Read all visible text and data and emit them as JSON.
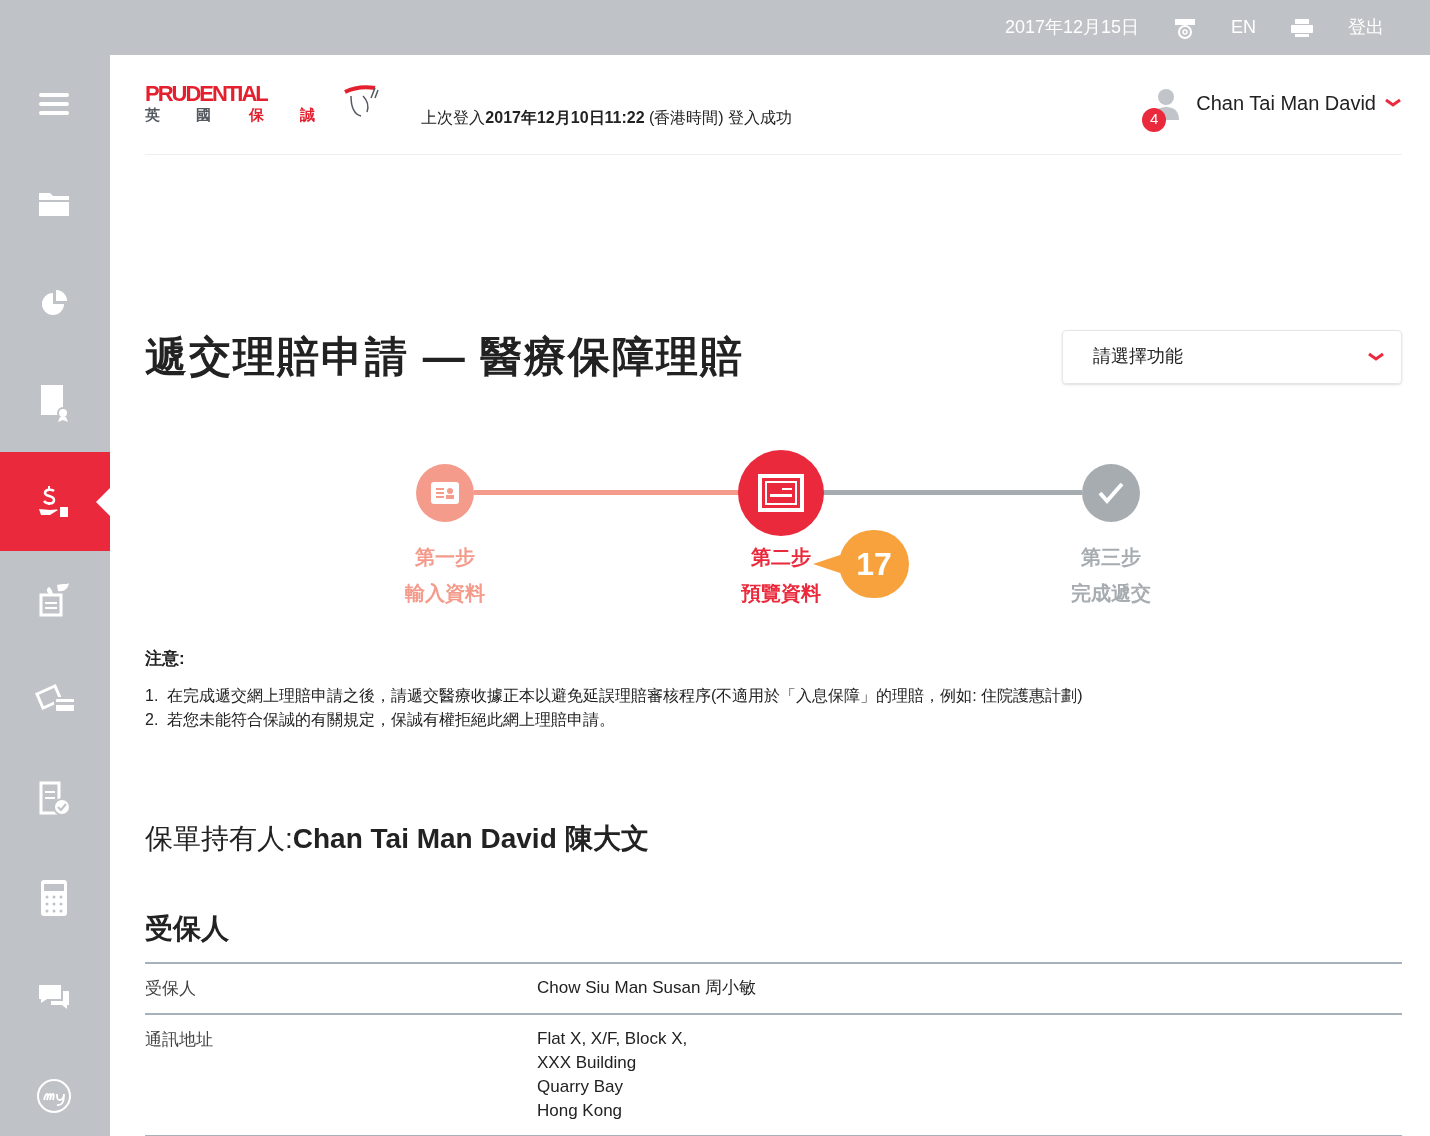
{
  "top_bar": {
    "date": "2017年12月15日",
    "language": "EN",
    "logout": "登出"
  },
  "sidebar": {
    "items": [
      {
        "kind": "menu",
        "selected": false
      },
      {
        "kind": "folder",
        "selected": false
      },
      {
        "kind": "pie",
        "selected": false
      },
      {
        "kind": "certificate",
        "selected": false
      },
      {
        "kind": "claim",
        "selected": true
      },
      {
        "kind": "plant",
        "selected": false
      },
      {
        "kind": "payment",
        "selected": false
      },
      {
        "kind": "checklist",
        "selected": false
      },
      {
        "kind": "calculator",
        "selected": false
      },
      {
        "kind": "chat",
        "selected": false
      },
      {
        "kind": "my",
        "selected": false
      }
    ]
  },
  "header": {
    "logo": {
      "brand": "PRUDENTIAL",
      "chinese_left": "英 國",
      "chinese_right": "保 誠"
    },
    "last_login": "上次登入**2017年12月10日11:22** (香港時間) 登入成功",
    "user": {
      "name": "Chan Tai Man David",
      "notifications": "4"
    }
  },
  "page": {
    "title": "遞交理賠申請 — 醫療保障理賠",
    "function_select": {
      "placeholder": "請選擇功能"
    }
  },
  "steps": [
    {
      "completed": true,
      "selected": false,
      "step": "第一步",
      "label": "輸入資料"
    },
    {
      "completed": false,
      "selected": true,
      "step": "第二步",
      "label": "預覽資料"
    },
    {
      "completed": false,
      "selected": false,
      "step": "第三步",
      "label": "完成遞交"
    }
  ],
  "callout": "17",
  "notice": {
    "heading": "注意:",
    "items": [
      {
        "number": "1.",
        "text": "在完成遞交網上理賠申請之後，請遞交醫療收據正本以避免延誤理賠審核程序(不適用於「入息保障」的理賠，例如: 住院護惠計劃)"
      },
      {
        "number": "2.",
        "text": "若您未能符合保誠的有關規定，保誠有權拒絕此網上理賠申請。"
      }
    ]
  },
  "policy_holder": {
    "label": "保單持有人:",
    "value": "Chan Tai Man David 陳大文"
  },
  "insured": {
    "heading": "受保人",
    "rows": [
      {
        "label": "受保人",
        "lines": [
          "Chow Siu Man Susan 周小敏"
        ]
      },
      {
        "label": "通訊地址",
        "lines": [
          "Flat X, X/F, Block X,",
          "XXX Building",
          "Quarry Bay",
          "Hong Kong"
        ]
      }
    ]
  }
}
